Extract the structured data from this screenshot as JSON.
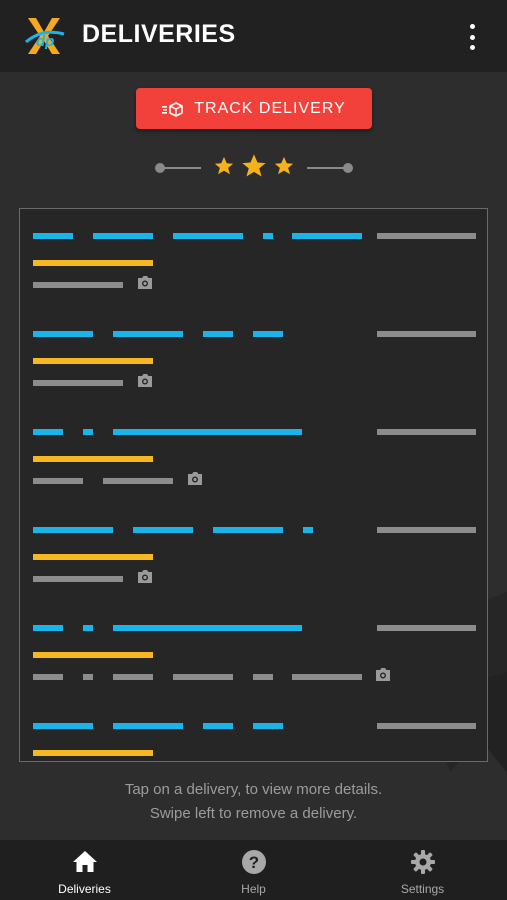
{
  "app": {
    "title": "DELIVERIES",
    "logo_text": "dp"
  },
  "actions": {
    "track_label": "TRACK DELIVERY",
    "rating_stars": 3
  },
  "colors": {
    "accent_red": "#f2413a",
    "tracking_blue": "#1ab4ea",
    "status_yellow": "#f6b822",
    "star_gold": "#f5b21b"
  },
  "deliveries": [
    {
      "has_photo": true
    },
    {
      "has_photo": true
    },
    {
      "has_photo": true
    },
    {
      "has_photo": true
    },
    {
      "has_photo": true
    },
    {
      "has_photo": false
    }
  ],
  "hint": {
    "line1": "Tap on a delivery, to view more details.",
    "line2": "Swipe left to remove a delivery."
  },
  "nav": {
    "items": [
      {
        "label": "Deliveries",
        "icon": "home-icon"
      },
      {
        "label": "Help",
        "icon": "help-icon"
      },
      {
        "label": "Settings",
        "icon": "gear-icon"
      }
    ]
  }
}
